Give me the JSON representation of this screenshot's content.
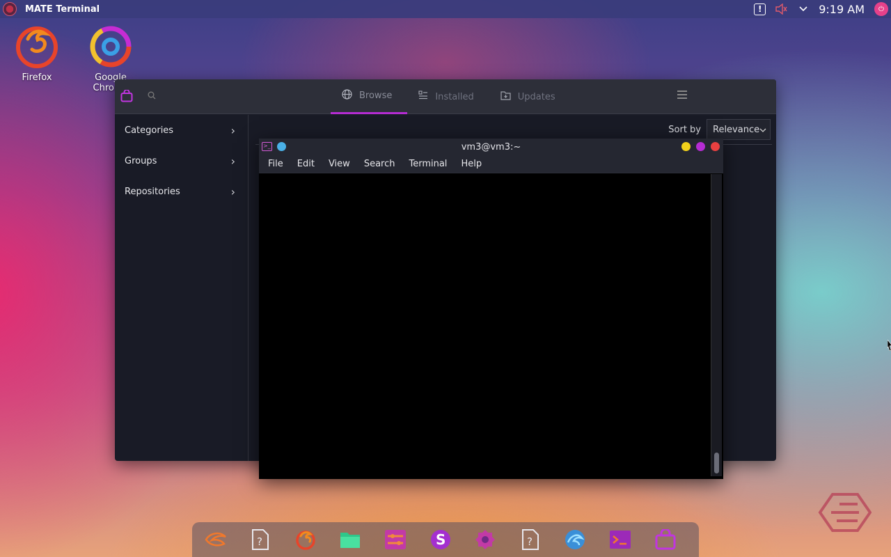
{
  "top_panel": {
    "app_name": "MATE Terminal",
    "alert_glyph": "!",
    "mute_glyph": "🔇",
    "dropdown_glyph": "⌄",
    "clock": "9:19 AM"
  },
  "desktop_icons": [
    {
      "label": "Firefox",
      "icon": "firefox-icon"
    },
    {
      "label": "Google Chrome",
      "icon": "chrome-icon"
    }
  ],
  "store": {
    "tabs": [
      {
        "label": "Browse",
        "icon": "globe-icon",
        "active": true
      },
      {
        "label": "Installed",
        "icon": "list-icon",
        "active": false
      },
      {
        "label": "Updates",
        "icon": "folder-update-icon",
        "active": false
      }
    ],
    "sidebar": [
      {
        "label": "Categories"
      },
      {
        "label": "Groups"
      },
      {
        "label": "Repositories"
      }
    ],
    "sort_label": "Sort by",
    "sort_value": "Relevance",
    "chevron": "›",
    "dropdown_chevron": "⌄"
  },
  "terminal": {
    "title": "vm3@vm3:~",
    "menu": [
      "File",
      "Edit",
      "View",
      "Search",
      "Terminal",
      "Help"
    ],
    "colors": {
      "minimize": "#f2d11b",
      "maximize": "#b52cd3",
      "close": "#e84040",
      "sticky": "#4ab0e6"
    }
  },
  "dock": {
    "items": [
      "garuda-icon",
      "unknown-app-icon",
      "firefox-icon",
      "files-icon",
      "settings-icon",
      "store-s-icon",
      "gear-icon",
      "unknown-app-icon",
      "browser-icon",
      "terminal-icon",
      "store-bag-icon"
    ]
  }
}
